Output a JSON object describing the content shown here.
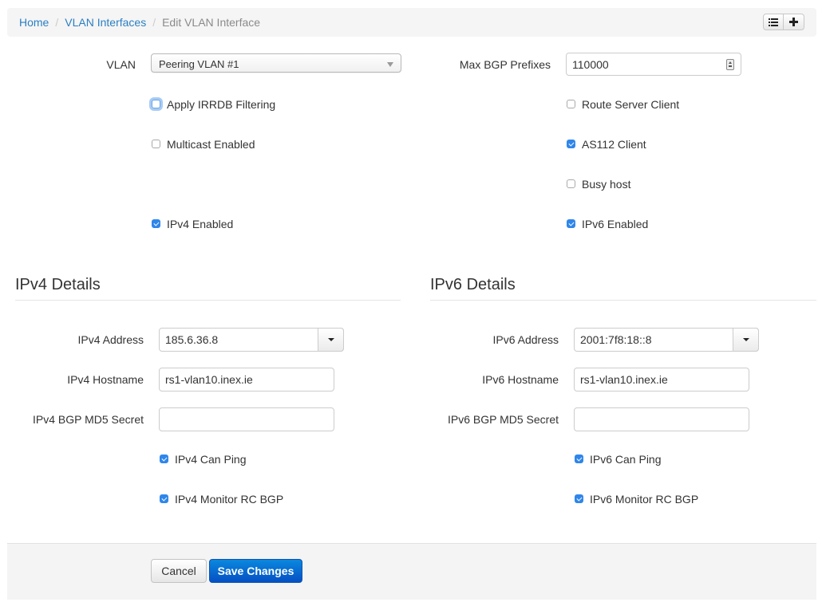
{
  "breadcrumb": {
    "items": [
      {
        "label": "Home",
        "link": true
      },
      {
        "label": "VLAN Interfaces",
        "link": true
      },
      {
        "label": "Edit VLAN Interface",
        "link": false
      }
    ],
    "separator": "/",
    "actions": [
      {
        "icon": "list-icon",
        "label": "List"
      },
      {
        "icon": "plus-icon",
        "label": "Add"
      }
    ]
  },
  "general": {
    "vlan": {
      "label": "VLAN",
      "value": "Peering VLAN #1"
    },
    "max_bgp_prefixes": {
      "label": "Max BGP Prefixes",
      "value": "110000"
    },
    "left_checkboxes": [
      {
        "label": "Apply IRRDB Filtering",
        "checked": false,
        "focused": true
      },
      {
        "label": "Multicast Enabled",
        "checked": false
      },
      {
        "label": "IPv4 Enabled",
        "checked": true
      }
    ],
    "right_checkboxes": [
      {
        "label": "Route Server Client",
        "checked": false
      },
      {
        "label": "AS112 Client",
        "checked": true
      },
      {
        "label": "Busy host",
        "checked": false
      },
      {
        "label": "IPv6 Enabled",
        "checked": true
      }
    ]
  },
  "ipv4": {
    "heading": "IPv4 Details",
    "address": {
      "label": "IPv4 Address",
      "value": "185.6.36.8"
    },
    "hostname": {
      "label": "IPv4 Hostname",
      "value": "rs1-vlan10.inex.ie"
    },
    "md5": {
      "label": "IPv4 BGP MD5 Secret",
      "value": ""
    },
    "can_ping": {
      "label": "IPv4 Can Ping",
      "checked": true
    },
    "monitor_rc_bgp": {
      "label": "IPv4 Monitor RC BGP",
      "checked": true
    }
  },
  "ipv6": {
    "heading": "IPv6 Details",
    "address": {
      "label": "IPv6 Address",
      "value": "2001:7f8:18::8"
    },
    "hostname": {
      "label": "IPv6 Hostname",
      "value": "rs1-vlan10.inex.ie"
    },
    "md5": {
      "label": "IPv6 BGP MD5 Secret",
      "value": ""
    },
    "can_ping": {
      "label": "IPv6 Can Ping",
      "checked": true
    },
    "monitor_rc_bgp": {
      "label": "IPv6 Monitor RC BGP",
      "checked": true
    }
  },
  "footer": {
    "cancel_label": "Cancel",
    "save_label": "Save Changes"
  },
  "colors": {
    "link": "#2a7fc3",
    "primary": "#0a6fd4",
    "checkbox_checked": "#2f86ea"
  }
}
